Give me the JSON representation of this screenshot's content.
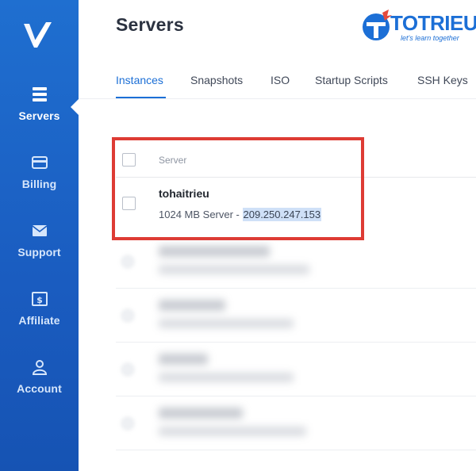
{
  "sidebar": {
    "logo_icon": "vultr-v-logo",
    "items": [
      {
        "label": "Servers",
        "icon": "servers-icon",
        "active": true
      },
      {
        "label": "Billing",
        "icon": "credit-card-icon",
        "active": false
      },
      {
        "label": "Support",
        "icon": "envelope-icon",
        "active": false
      },
      {
        "label": "Affiliate",
        "icon": "dollar-bill-icon",
        "active": false
      },
      {
        "label": "Account",
        "icon": "user-icon",
        "active": false
      }
    ]
  },
  "header": {
    "title": "Servers",
    "brand_name": "TOTRIEU",
    "brand_tagline": "let's learn together"
  },
  "tabs": [
    {
      "label": "Instances",
      "active": true
    },
    {
      "label": "Snapshots",
      "active": false
    },
    {
      "label": "ISO",
      "active": false
    },
    {
      "label": "Startup Scripts",
      "active": false
    },
    {
      "label": "SSH Keys",
      "active": false
    }
  ],
  "table": {
    "column_header": "Server",
    "rows": [
      {
        "name": "tohaitrieu",
        "desc_prefix": "1024 MB Server - ",
        "ip": "209.250.247.153"
      }
    ]
  },
  "colors": {
    "accent": "#1c6fd6",
    "sidebar": "#1a5cc0",
    "highlight_border": "#de3b34"
  }
}
